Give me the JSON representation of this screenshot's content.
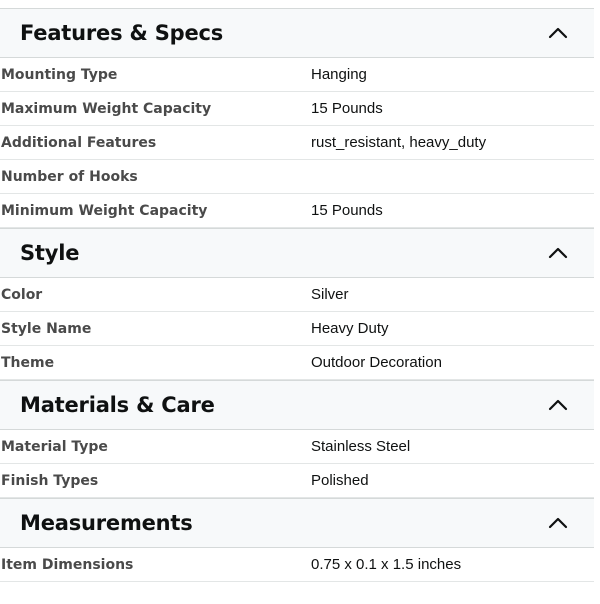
{
  "sections": [
    {
      "title": "Features & Specs",
      "rows": [
        {
          "label": "Mounting Type",
          "value": "Hanging"
        },
        {
          "label": "Maximum Weight Capacity",
          "value": "15 Pounds"
        },
        {
          "label": "Additional Features",
          "value": "rust_resistant, heavy_duty"
        },
        {
          "label": "Number of Hooks",
          "value": ""
        },
        {
          "label": "Minimum Weight Capacity",
          "value": "15 Pounds"
        }
      ]
    },
    {
      "title": "Style",
      "rows": [
        {
          "label": "Color",
          "value": "Silver"
        },
        {
          "label": "Style Name",
          "value": "Heavy Duty"
        },
        {
          "label": "Theme",
          "value": "Outdoor Decoration"
        }
      ]
    },
    {
      "title": "Materials & Care",
      "rows": [
        {
          "label": "Material Type",
          "value": "Stainless Steel"
        },
        {
          "label": "Finish Types",
          "value": "Polished"
        }
      ]
    },
    {
      "title": "Measurements",
      "rows": [
        {
          "label": "Item Dimensions",
          "value": "0.75 x 0.1 x 1.5 inches"
        }
      ]
    }
  ],
  "icons": {
    "collapse": "chevron-up-icon"
  },
  "colors": {
    "header_bg": "#f7f9fa",
    "border": "#d5d9d9",
    "label_text": "#4a4a4a"
  }
}
